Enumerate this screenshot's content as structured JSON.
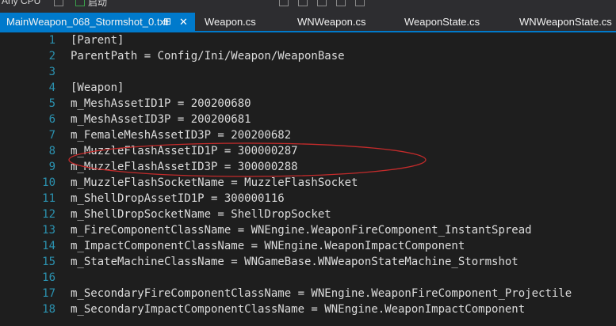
{
  "toolbar": {
    "config_label": "Any CPU",
    "run_label": "启动"
  },
  "tabs": [
    {
      "label": "MainWeapon_068_Stormshot_0.txt",
      "active": true
    },
    {
      "label": "Weapon.cs"
    },
    {
      "label": "WNWeapon.cs"
    },
    {
      "label": "WeaponState.cs"
    },
    {
      "label": "WNWeaponState.cs"
    }
  ],
  "lines": [
    {
      "num": "1",
      "text": "[Parent]"
    },
    {
      "num": "2",
      "text": "ParentPath = Config/Ini/Weapon/WeaponBase"
    },
    {
      "num": "3",
      "text": ""
    },
    {
      "num": "4",
      "text": "[Weapon]"
    },
    {
      "num": "5",
      "text": "m_MeshAssetID1P = 200200680"
    },
    {
      "num": "6",
      "text": "m_MeshAssetID3P = 200200681"
    },
    {
      "num": "7",
      "text": "m_FemaleMeshAssetID3P = 200200682"
    },
    {
      "num": "8",
      "text": "m_MuzzleFlashAssetID1P = 300000287"
    },
    {
      "num": "9",
      "text": "m_MuzzleFlashAssetID3P = 300000288"
    },
    {
      "num": "10",
      "text": "m_MuzzleFlashSocketName = MuzzleFlashSocket"
    },
    {
      "num": "11",
      "text": "m_ShellDropAssetID1P = 300000116"
    },
    {
      "num": "12",
      "text": "m_ShellDropSocketName = ShellDropSocket"
    },
    {
      "num": "13",
      "text": "m_FireComponentClassName = WNEngine.WeaponFireComponent_InstantSpread"
    },
    {
      "num": "14",
      "text": "m_ImpactComponentClassName = WNEngine.WeaponImpactComponent"
    },
    {
      "num": "15",
      "text": "m_StateMachineClassName = WNGameBase.WNWeaponStateMachine_Stormshot"
    },
    {
      "num": "16",
      "text": ""
    },
    {
      "num": "17",
      "text": "m_SecondaryFireComponentClassName = WNEngine.WeaponFireComponent_Projectile"
    },
    {
      "num": "18",
      "text": "m_SecondaryImpactComponentClassName = WNEngine.WeaponImpactComponent"
    }
  ],
  "colors": {
    "accent": "#007acc",
    "annotation": "#c42b2b",
    "line_number": "#2b91af",
    "code_text": "#dcdcdc"
  }
}
